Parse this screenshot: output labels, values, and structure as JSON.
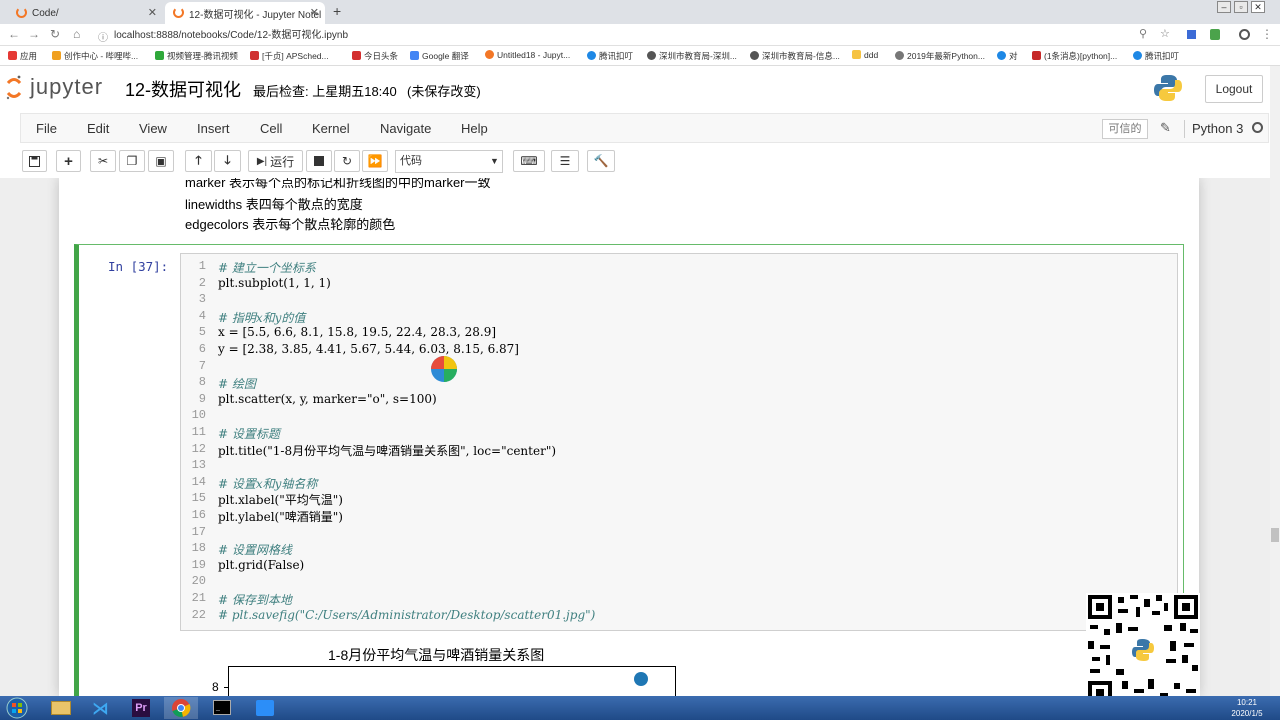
{
  "browser": {
    "tabs": [
      {
        "title": "Code/",
        "active": false
      },
      {
        "title": "12-数据可视化 - Jupyter Notel",
        "active": true
      }
    ],
    "url": "localhost:8888/notebooks/Code/12-数据可视化.ipynb",
    "bookmarks": [
      "应用",
      "创作中心 - 哔哩哔...",
      "视频管理-腾讯视频",
      "[千贞] APSched...",
      "今日头条",
      "Google 翻译",
      "Untitled18 - Jupyt...",
      "腾讯扣叮",
      "深圳市教育局-深圳...",
      "深圳市教育局-信息...",
      "ddd",
      "2019年最新Python...",
      "对",
      "(1条消息)[python]...",
      "腾讯扣叮"
    ]
  },
  "jupyter": {
    "logo_text": "jupyter",
    "notebook_title": "12-数据可视化",
    "checkpoint": "最后检查: 上星期五18:40",
    "unsaved": "(未保存改变)",
    "logout": "Logout",
    "menus": [
      "File",
      "Edit",
      "View",
      "Insert",
      "Cell",
      "Kernel",
      "Navigate",
      "Help"
    ],
    "trusted": "可信的",
    "kernel": "Python 3",
    "toolbar": {
      "run_label": "运行",
      "cell_type": "代码"
    }
  },
  "markdown": [
    "marker 表示每个点的标记和折线图的中的marker一致",
    "linewidths 表四每个散点的宽度",
    "edgecolors 表示每个散点轮廓的颜色"
  ],
  "cell": {
    "prompt": "In  [37]:",
    "lines": [
      "# 建立一个坐标系",
      "plt.subplot(1, 1, 1)",
      "",
      "# 指明x和y的值",
      "x = [5.5, 6.6, 8.1, 15.8, 19.5, 22.4, 28.3, 28.9]",
      "y = [2.38, 3.85, 4.41, 5.67, 5.44, 6.03, 8.15, 6.87]",
      "",
      "# 绘图",
      "plt.scatter(x, y, marker=\"o\", s=100)",
      "",
      "# 设置标题",
      "plt.title(\"1-8月份平均气温与啤酒销量关系图\", loc=\"center\")",
      "",
      "# 设置x和y轴名称",
      "plt.xlabel(\"平均气温\")",
      "plt.ylabel(\"啤酒销量\")",
      "",
      "# 设置网格线",
      "plt.grid(False)",
      "",
      "# 保存到本地",
      "# plt.savefig(\"C:/Users/Administrator/Desktop/scatter01.jpg\")"
    ]
  },
  "chart_data": {
    "type": "scatter",
    "title": "1-8月份平均气温与啤酒销量关系图",
    "x": [
      5.5,
      6.6,
      8.1,
      15.8,
      19.5,
      22.4,
      28.3,
      28.9
    ],
    "y": [
      2.38,
      3.85,
      4.41,
      5.67,
      5.44,
      6.03,
      8.15,
      6.87
    ],
    "visible_ytick": "8",
    "color": "#1f77b4"
  },
  "taskbar": {
    "time": "10:21",
    "date": "2020/1/5"
  }
}
